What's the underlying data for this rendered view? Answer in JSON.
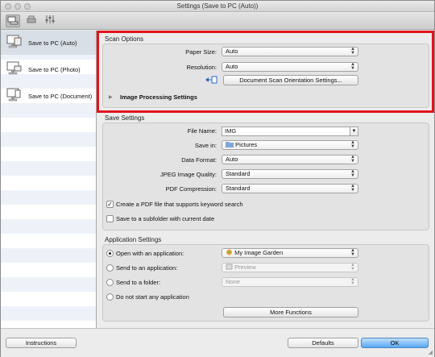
{
  "window": {
    "title": "Settings (Save to PC (Auto))"
  },
  "toolbar": {
    "icons": [
      "scan-from-computer-icon",
      "scan-from-panel-icon",
      "general-settings-icon"
    ]
  },
  "sidebar": {
    "items": [
      {
        "label": "Save to PC (Auto)",
        "selected": true
      },
      {
        "label": "Save to PC (Photo)",
        "selected": false
      },
      {
        "label": "Save to PC (Document)",
        "selected": false
      }
    ]
  },
  "scan_options": {
    "title": "Scan Options",
    "paper_size": {
      "label": "Paper Size:",
      "value": "Auto"
    },
    "resolution": {
      "label": "Resolution:",
      "value": "Auto"
    },
    "orientation_button": "Document Scan Orientation Settings...",
    "image_processing": "Image Processing Settings"
  },
  "save_settings": {
    "title": "Save Settings",
    "file_name": {
      "label": "File Name:",
      "value": "IMG"
    },
    "save_in": {
      "label": "Save in:",
      "value": "Pictures"
    },
    "data_format": {
      "label": "Data Format:",
      "value": "Auto"
    },
    "jpeg_quality": {
      "label": "JPEG Image Quality:",
      "value": "Standard"
    },
    "pdf_compression": {
      "label": "PDF Compression:",
      "value": "Standard"
    },
    "keyword_pdf": {
      "label": "Create a PDF file that supports keyword search",
      "checked": true
    },
    "subfolder": {
      "label": "Save to a subfolder with current date",
      "checked": false
    }
  },
  "application_settings": {
    "title": "Application Settings",
    "open_with": {
      "label": "Open with an application:",
      "value": "My Image Garden",
      "selected": true
    },
    "send_to_app": {
      "label": "Send to an application:",
      "value": "Preview",
      "selected": false
    },
    "send_to_folder": {
      "label": "Send to a folder:",
      "value": "None",
      "selected": false
    },
    "do_not_start": {
      "label": "Do not start any application",
      "selected": false
    },
    "more_functions": "More Functions"
  },
  "footer": {
    "instructions": "Instructions",
    "defaults": "Defaults",
    "ok": "OK"
  },
  "colors": {
    "highlight": "#e2131c",
    "ok_button": "#5aa7f2",
    "selected_item": "#d9dfe7"
  }
}
